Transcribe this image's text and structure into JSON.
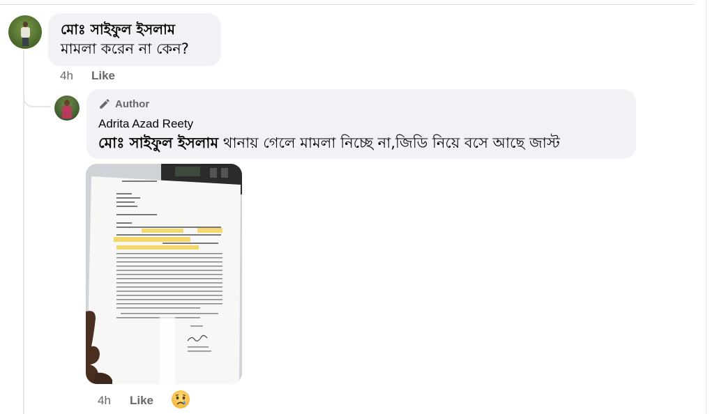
{
  "comment": {
    "author_name": "মোঃ সাইফুল ইসলাম",
    "text": "মামলা করেন না কেন?",
    "time": "4h",
    "like_label": "Like"
  },
  "reply": {
    "badge_label": "Author",
    "author_name": "Adrita Azad Reety",
    "mention": "মোঃ সাইফুল ইসলাম",
    "text": " থানায় গেলে মামলা নিচ্ছে না,জিডি নিয়ে বসে আছে জাস্ট",
    "time": "4h",
    "like_label": "Like",
    "reaction_icon": "sad-cry-emoji-icon",
    "attachment_icon": "document-photo"
  },
  "colors": {
    "bubble_bg": "#f0f2f5",
    "secondary_text": "#65676b",
    "primary_text": "#050505",
    "thread_line": "#e4e6eb"
  }
}
